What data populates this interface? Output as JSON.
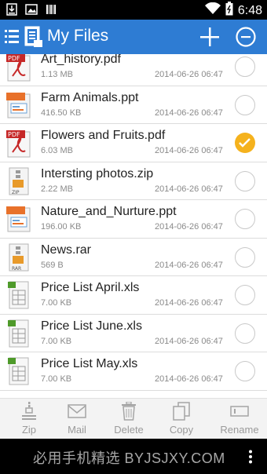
{
  "status_bar": {
    "time": "6:48",
    "left_icons": [
      "download-icon",
      "image-icon",
      "barcode-icon"
    ],
    "right_icons": [
      "wifi-icon",
      "battery-icon"
    ]
  },
  "header": {
    "title": "My Files",
    "color": "#2e7cd3"
  },
  "files": [
    {
      "name": "Art_history.pdf",
      "size": "1.13 MB",
      "date": "2014-06-26 06:47",
      "type": "pdf",
      "checked": false
    },
    {
      "name": "Farm Animals.ppt",
      "size": "416.50 KB",
      "date": "2014-06-26 06:47",
      "type": "ppt",
      "checked": false
    },
    {
      "name": "Flowers and Fruits.pdf",
      "size": "6.03 MB",
      "date": "2014-06-26 06:47",
      "type": "pdf",
      "checked": true
    },
    {
      "name": "Intersting photos.zip",
      "size": "2.22 MB",
      "date": "2014-06-26 06:47",
      "type": "zip",
      "checked": false
    },
    {
      "name": "Nature_and_Nurture.ppt",
      "size": "196.00 KB",
      "date": "2014-06-26 06:47",
      "type": "ppt",
      "checked": false
    },
    {
      "name": "News.rar",
      "size": "569 B",
      "date": "2014-06-26 06:47",
      "type": "rar",
      "checked": false
    },
    {
      "name": "Price List April.xls",
      "size": "7.00 KB",
      "date": "2014-06-26 06:47",
      "type": "xls",
      "checked": false
    },
    {
      "name": "Price List June.xls",
      "size": "7.00 KB",
      "date": "2014-06-26 06:47",
      "type": "xls",
      "checked": false
    },
    {
      "name": "Price List May.xls",
      "size": "7.00 KB",
      "date": "2014-06-26 06:47",
      "type": "xls",
      "checked": false
    }
  ],
  "toolbar": {
    "zip_label": "Zip",
    "mail_label": "Mail",
    "delete_label": "Delete",
    "copy_label": "Copy",
    "rename_label": "Rename"
  },
  "watermark": "必用手机精选 BYJSJXY.COM",
  "colors": {
    "accent": "#2e7cd3",
    "check": "#f5b21d",
    "pdf": "#c62828",
    "ppt": "#e8712a",
    "xls": "#4e9a2a"
  }
}
